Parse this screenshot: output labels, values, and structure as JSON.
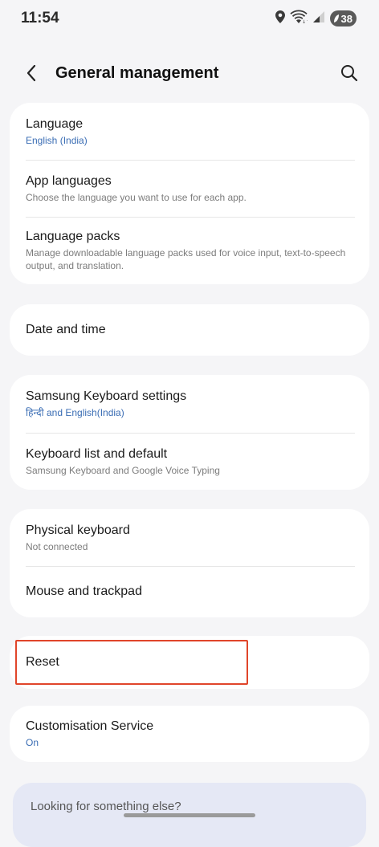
{
  "status": {
    "time": "11:54",
    "battery": "38",
    "icons": [
      "location-icon",
      "wifi-icon",
      "signal-icon",
      "battery-icon"
    ]
  },
  "header": {
    "title": "General management",
    "back_icon": "back-arrow-icon",
    "search_icon": "search-icon"
  },
  "groups": [
    {
      "items": [
        {
          "title": "Language",
          "subtitle": "English (India)",
          "accent": true
        },
        {
          "title": "App languages",
          "subtitle": "Choose the language you want to use for each app.",
          "accent": false
        },
        {
          "title": "Language packs",
          "subtitle": "Manage downloadable language packs used for voice input, text-to-speech output, and translation.",
          "accent": false
        }
      ]
    },
    {
      "items": [
        {
          "title": "Date and time"
        }
      ]
    },
    {
      "items": [
        {
          "title": "Samsung Keyboard settings",
          "subtitle": "हिन्दी and English(India)",
          "accent": true
        },
        {
          "title": "Keyboard list and default",
          "subtitle": "Samsung Keyboard and Google Voice Typing",
          "accent": false
        }
      ]
    },
    {
      "items": [
        {
          "title": "Physical keyboard",
          "subtitle": "Not connected",
          "accent": false
        },
        {
          "title": "Mouse and trackpad"
        }
      ]
    },
    {
      "items": [
        {
          "title": "Reset"
        }
      ]
    },
    {
      "items": [
        {
          "title": "Customisation Service",
          "subtitle": "On",
          "accent": true
        }
      ]
    }
  ],
  "hint": "Looking for something else?",
  "colors": {
    "accent": "#3a6db4",
    "highlight": "#e0452a",
    "background": "#f5f5f7",
    "card": "#ffffff"
  }
}
